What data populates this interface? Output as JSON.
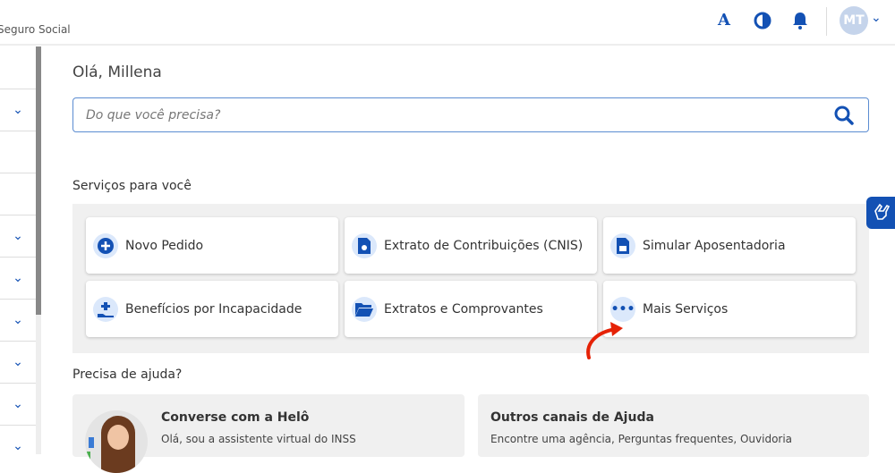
{
  "header": {
    "brand": "Seguro Social",
    "font_icon": "A",
    "avatar_initials": "MT"
  },
  "greeting": "Olá, Millena",
  "search": {
    "placeholder": "Do que você precisa?"
  },
  "services": {
    "title": "Serviços para você",
    "items": [
      {
        "label": "Novo Pedido",
        "icon": "plus-circle-icon"
      },
      {
        "label": "Extrato de Contribuições (CNIS)",
        "icon": "document-icon"
      },
      {
        "label": "Simular Aposentadoria",
        "icon": "calculator-document-icon"
      },
      {
        "label": "Benefícios por Incapacidade",
        "icon": "hand-plus-icon"
      },
      {
        "label": "Extratos e Comprovantes",
        "icon": "folder-icon"
      },
      {
        "label": "Mais Serviços",
        "icon": "more-icon"
      }
    ]
  },
  "help": {
    "title": "Precisa de ajuda?",
    "cards": [
      {
        "title": "Converse com a Helô",
        "subtitle": "Olá, sou a assistente virtual do INSS"
      },
      {
        "title": "Outros canais de Ajuda",
        "subtitle": "Encontre uma agência, Perguntas frequentes, Ouvidoria"
      }
    ]
  },
  "colors": {
    "primary": "#1351b4",
    "arrow": "#e52207"
  }
}
